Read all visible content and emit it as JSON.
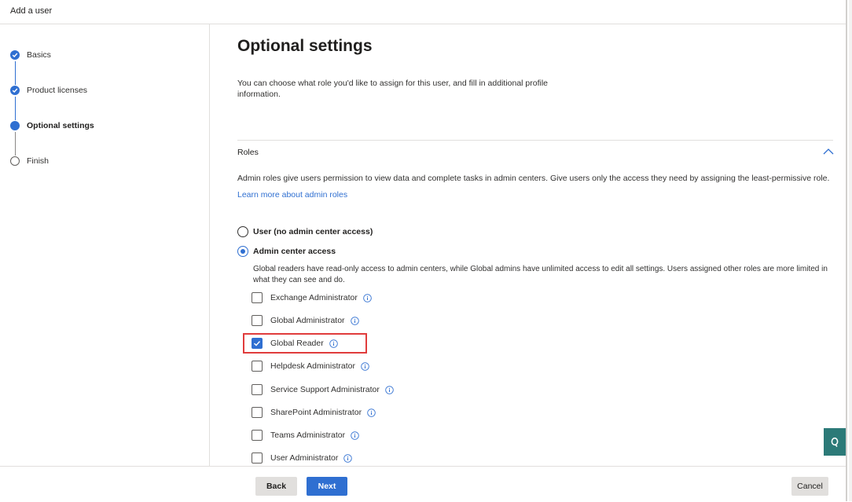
{
  "window": {
    "title": "Add a user"
  },
  "stepper": {
    "steps": [
      {
        "label": "Basics",
        "state": "done"
      },
      {
        "label": "Product licenses",
        "state": "done"
      },
      {
        "label": "Optional settings",
        "state": "current"
      },
      {
        "label": "Finish",
        "state": "todo"
      }
    ]
  },
  "main": {
    "title": "Optional settings",
    "intro": "You can choose what role you'd like to assign for this user, and fill in additional profile information.",
    "roles": {
      "section_title": "Roles",
      "description": "Admin roles give users permission to view data and complete tasks in admin centers. Give users only the access they need by assigning the least-permissive role.",
      "learn_more": "Learn more about admin roles",
      "options": [
        {
          "label": "User (no admin center access)",
          "selected": false
        },
        {
          "label": "Admin center access",
          "selected": true
        }
      ],
      "access_description": "Global readers have read-only access to admin centers, while Global admins have unlimited access to edit all settings. Users assigned other roles are more limited in what they can see and do.",
      "admin_roles": [
        {
          "label": "Exchange Administrator",
          "checked": false
        },
        {
          "label": "Global Administrator",
          "checked": false
        },
        {
          "label": "Global Reader",
          "checked": true
        },
        {
          "label": "Helpdesk Administrator",
          "checked": false
        },
        {
          "label": "Service Support Administrator",
          "checked": false
        },
        {
          "label": "SharePoint Administrator",
          "checked": false
        },
        {
          "label": "Teams Administrator",
          "checked": false
        },
        {
          "label": "User Administrator",
          "checked": false
        }
      ]
    }
  },
  "footer": {
    "back": "Back",
    "next": "Next",
    "cancel": "Cancel"
  },
  "colors": {
    "accent": "#2f6fd1",
    "highlight": "#e03c3c",
    "feedback": "#2c7a78"
  }
}
